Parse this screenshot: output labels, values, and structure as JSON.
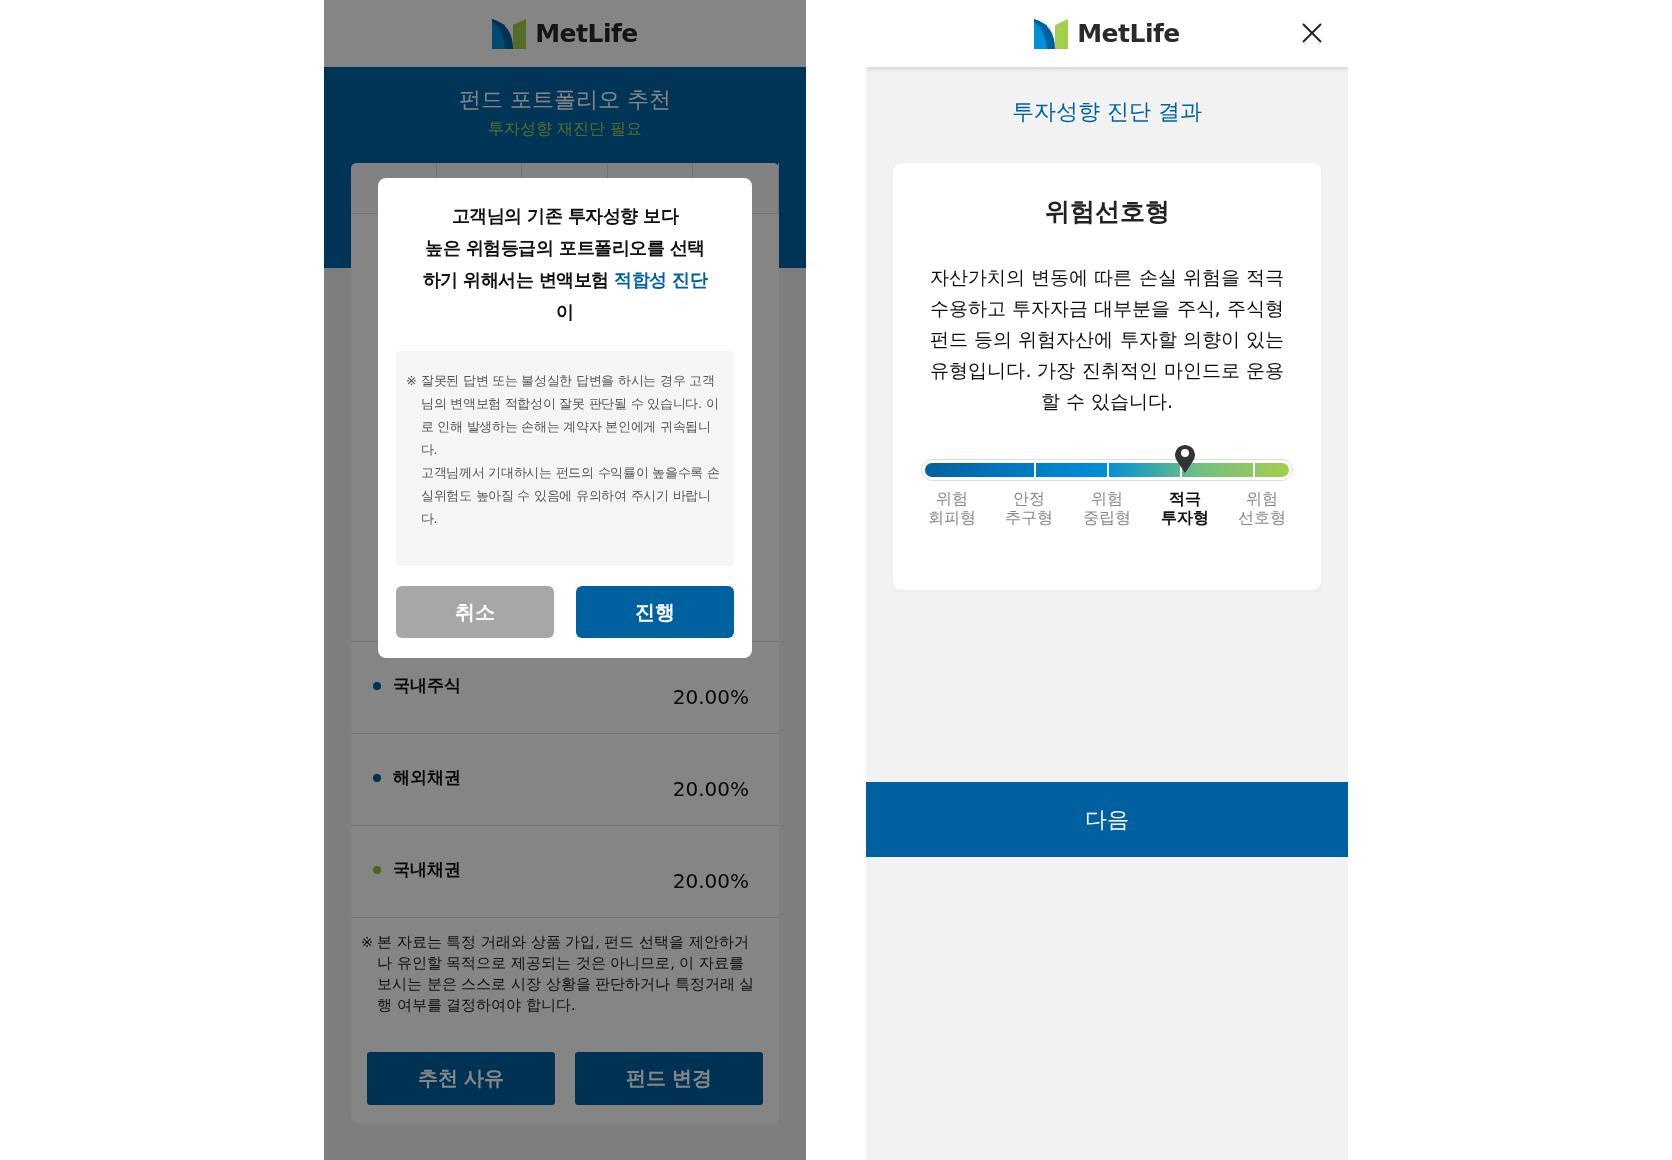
{
  "left_screen": {
    "logo_text": "MetLife",
    "title": "펀드 포트폴리오 추천",
    "subtitle": "투자성향 재진단 필요",
    "rows": [
      {
        "name": "국내주식",
        "value": "20.00%",
        "color": "#003253"
      },
      {
        "name": "해외채권",
        "value": "20.00%",
        "color": "#003253"
      },
      {
        "name": "국내채권",
        "value": "20.00%",
        "color": "#496721"
      }
    ],
    "notice": {
      "mark": "※",
      "text": "본 자료는 특정 거래와 상품 가입, 펀드 선택을 제안하거나 유인할 목적으로 제공되는 것은 아니므로, 이 자료를 보시는 분은 스스로 시장 상황을 판단하거나 특정거래 실행 여부를 결정하여야 합니다."
    },
    "buttons": [
      "추천 사유",
      "펀드 변경"
    ],
    "dialog": {
      "message_lines": [
        {
          "text": "고객님의 기존 투자성향 보다"
        },
        {
          "text": "높은 위험등급의 포트폴리오를 선택"
        },
        {
          "text": "하기 위해서는 변액보험",
          "link": "적합성 진단"
        },
        {
          "text": "이"
        }
      ],
      "warning": {
        "mark": "※",
        "paragraphs": [
          "잘못된 답변 또는 불성실한 답변을 하시는 경우 고객님의 변액보험 적합성이 잘못 판단될 수 있습니다. 이로 인해 발생하는 손해는 계약자 본인에게 귀속됩니다.",
          "고객님께서 기대하시는 펀드의 수익률이 높을수록 손실위험도 높아질 수 있음에 유의하여 주시기 바랍니다."
        ]
      },
      "cancel_button": "취소",
      "confirm_button": "진행"
    }
  },
  "right_screen": {
    "logo_text": "MetLife",
    "title": "투자성향 진단 결과",
    "result": "위험선호형",
    "description": "자산가치의 변동에 따른 손실 위험을 적극 수용하고 투자자금 대부분을 주식, 주식형 펀드 등의 위험자산에 투자할 의향이 있는 유형입니다. 가장 진취적인 마인드로 운용할 수 있습니다.",
    "scale": [
      {
        "line1": "위험",
        "line2": "회피형",
        "selected": false
      },
      {
        "line1": "안정",
        "line2": "추구형",
        "selected": false
      },
      {
        "line1": "위험",
        "line2": "중립형",
        "selected": false
      },
      {
        "line1": "적극",
        "line2": "투자형",
        "selected": true
      },
      {
        "line1": "위험",
        "line2": "선호형",
        "selected": false
      }
    ],
    "next_button": "다음"
  }
}
